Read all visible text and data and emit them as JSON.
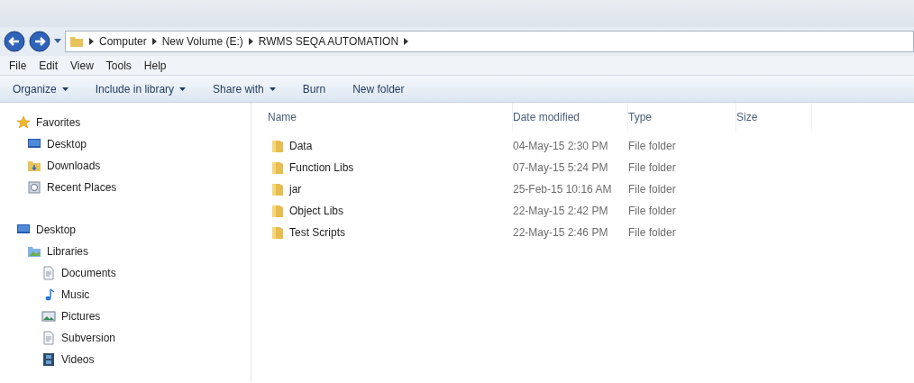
{
  "address_bar": {
    "breadcrumbs": [
      "Computer",
      "New Volume (E:)",
      "RWMS SEQA AUTOMATION"
    ]
  },
  "menu_bar": [
    "File",
    "Edit",
    "View",
    "Tools",
    "Help"
  ],
  "toolbar": [
    {
      "label": "Organize",
      "dropdown": true
    },
    {
      "label": "Include in library",
      "dropdown": true
    },
    {
      "label": "Share with",
      "dropdown": true
    },
    {
      "label": "Burn",
      "dropdown": false
    },
    {
      "label": "New folder",
      "dropdown": false
    }
  ],
  "sidebar": [
    {
      "label": "Favorites",
      "kind": "star",
      "children": [
        {
          "label": "Desktop",
          "kind": "desktop"
        },
        {
          "label": "Downloads",
          "kind": "downloads"
        },
        {
          "label": "Recent Places",
          "kind": "recent"
        }
      ]
    },
    {
      "label": "Desktop",
      "kind": "desktop",
      "children": [
        {
          "label": "Libraries",
          "kind": "libraries",
          "children": [
            {
              "label": "Documents",
              "kind": "documents"
            },
            {
              "label": "Music",
              "kind": "music"
            },
            {
              "label": "Pictures",
              "kind": "pictures"
            },
            {
              "label": "Subversion",
              "kind": "documents"
            },
            {
              "label": "Videos",
              "kind": "videos"
            }
          ]
        }
      ]
    }
  ],
  "table": {
    "columns": [
      "Name",
      "Date modified",
      "Type",
      "Size"
    ],
    "rows": [
      {
        "name": "Data",
        "date_modified": "04-May-15 2:30 PM",
        "type": "File folder"
      },
      {
        "name": "Function Libs",
        "date_modified": "07-May-15 5:24 PM",
        "type": "File folder"
      },
      {
        "name": "jar",
        "date_modified": "25-Feb-15 10:16 AM",
        "type": "File folder"
      },
      {
        "name": "Object Libs",
        "date_modified": "22-May-15 2:42 PM",
        "type": "File folder"
      },
      {
        "name": "Test Scripts",
        "date_modified": "22-May-15 2:46 PM",
        "type": "File folder"
      }
    ]
  }
}
